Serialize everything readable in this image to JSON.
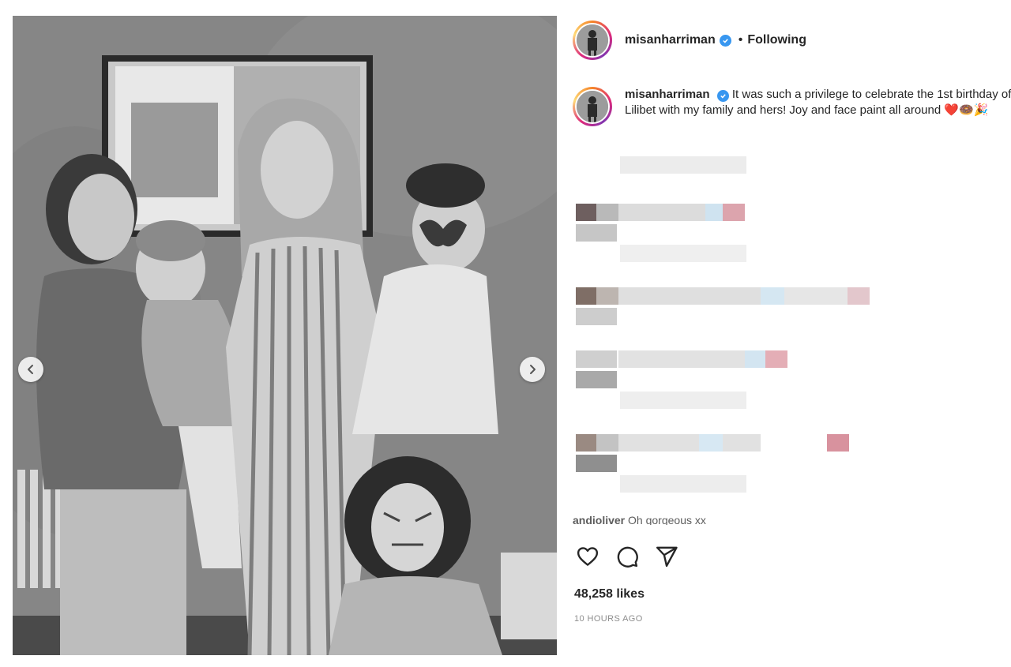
{
  "post": {
    "username": "misanharriman",
    "follow_state": "Following",
    "separator": "•",
    "caption": "It was such a privilege to celebrate the 1st birthday of Lilibet with my family and hers! Joy and face paint all around",
    "caption_emoji": "❤️🍩🎉",
    "likes": "48,258 likes",
    "timestamp": "10 HOURS AGO"
  },
  "comment_peek": {
    "username": "andioliver",
    "text": "Oh gorgeous xx"
  },
  "icons": {
    "verified": "verified-badge-icon",
    "like": "heart-icon",
    "comment": "comment-icon",
    "share": "send-icon",
    "prev": "chevron-left-icon",
    "next": "chevron-right-icon"
  },
  "colors": {
    "verified": "#3897f0",
    "story_ring_start": "#f58529",
    "story_ring_end": "#dd2a7b"
  }
}
